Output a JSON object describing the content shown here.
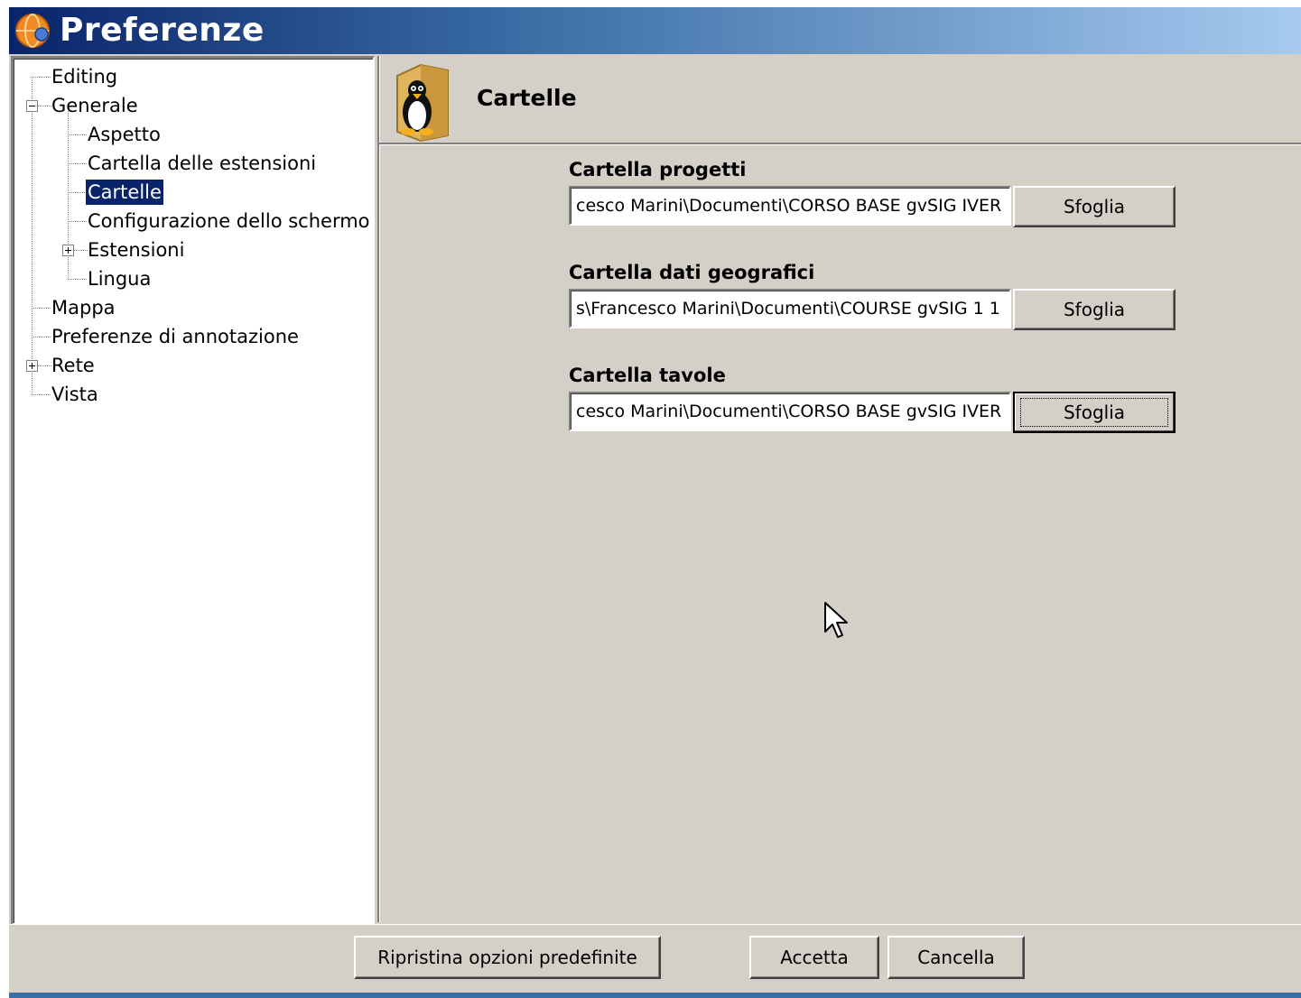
{
  "window": {
    "title": "Preferenze",
    "icon": "gvsig-globe-icon"
  },
  "tree": {
    "items": [
      {
        "label": "Editing"
      },
      {
        "label": "Generale",
        "expanded": true
      },
      {
        "label": "Aspetto"
      },
      {
        "label": "Cartella delle estensioni"
      },
      {
        "label": "Cartelle",
        "selected": true
      },
      {
        "label": "Configurazione dello schermo"
      },
      {
        "label": "Estensioni",
        "expanded": false
      },
      {
        "label": "Lingua"
      },
      {
        "label": "Mappa"
      },
      {
        "label": "Preferenze di annotazione"
      },
      {
        "label": "Rete",
        "expanded": false
      },
      {
        "label": "Vista"
      }
    ]
  },
  "page": {
    "title": "Cartelle",
    "icon": "penguin-folder-icon"
  },
  "fields": [
    {
      "label": "Cartella progetti",
      "value": "cesco Marini\\Documenti\\CORSO BASE gvSIG IVER",
      "button": "Sfoglia"
    },
    {
      "label": "Cartella dati geografici",
      "value": "s\\Francesco Marini\\Documenti\\COURSE gvSIG 1 1",
      "button": "Sfoglia"
    },
    {
      "label": "Cartella tavole",
      "value": "cesco Marini\\Documenti\\CORSO BASE gvSIG IVER",
      "button": "Sfoglia"
    }
  ],
  "footer": {
    "restore_label": "Ripristina opzioni predefinite",
    "accept_label": "Accetta",
    "cancel_label": "Cancella"
  },
  "colors": {
    "title_gradient_start": "#0a246a",
    "title_gradient_end": "#a6caf0",
    "dialog_bg": "#d4d0c8",
    "selection_bg": "#0a246a"
  }
}
